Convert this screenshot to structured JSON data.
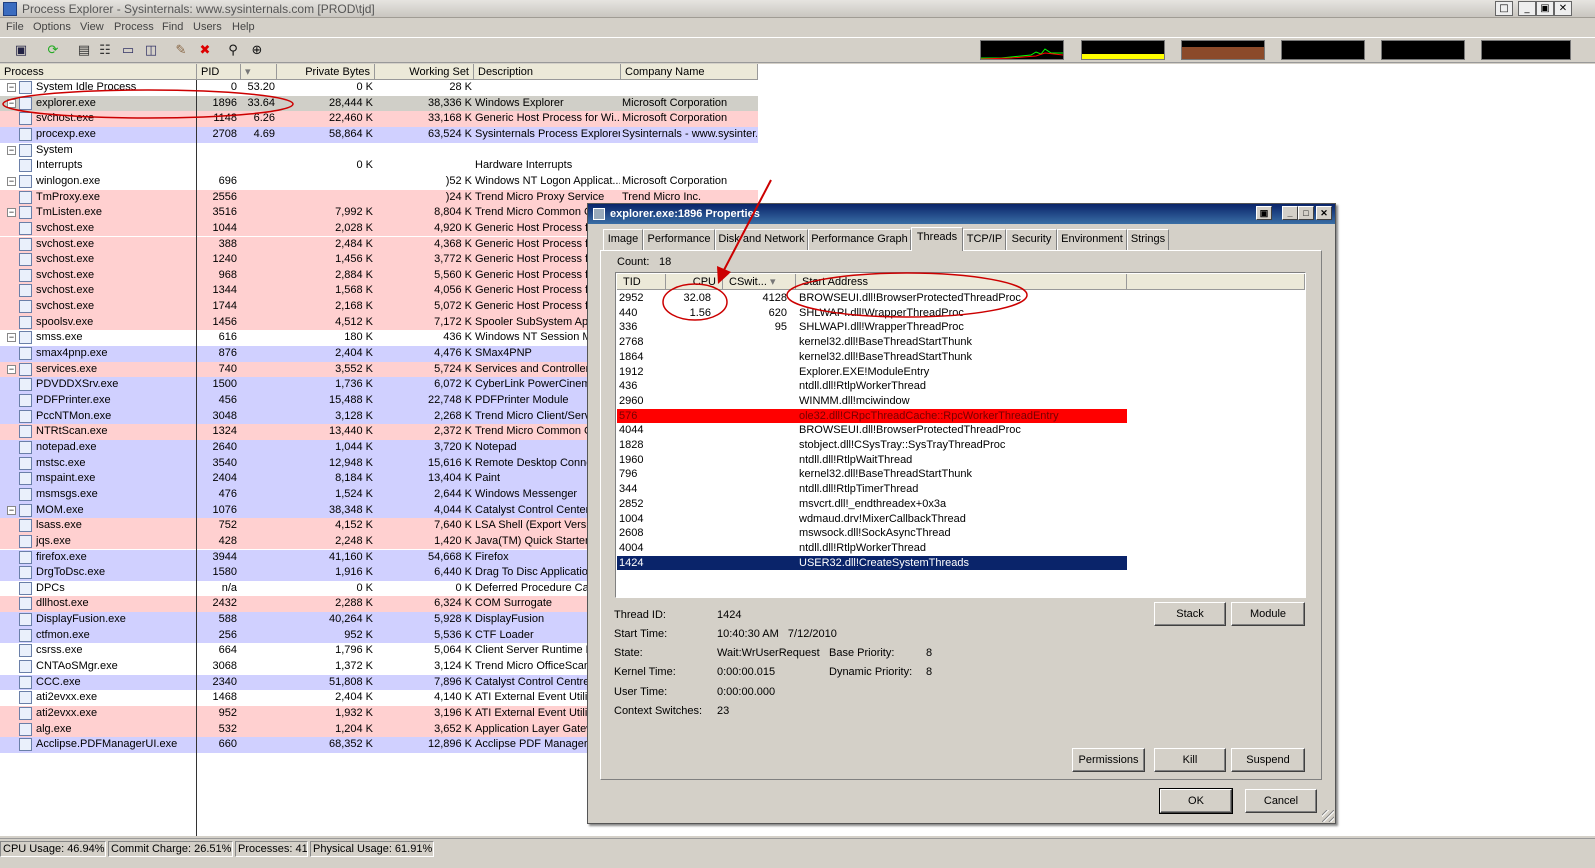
{
  "window": {
    "title": "Process Explorer - Sysinternals: www.sysinternals.com [PROD\\tjd]",
    "controls": [
      "□",
      "_",
      "▣",
      "✕"
    ]
  },
  "menu": [
    "File",
    "Options",
    "View",
    "Process",
    "Find",
    "Users",
    "Help"
  ],
  "toolbar": {
    "icons": [
      "save-icon",
      "refresh-icon",
      "system-info-icon",
      "process-tree-icon",
      "lower-pane-icon",
      "find-window-icon",
      "properties-icon",
      "kill-process-icon",
      "find-handle-icon",
      "target-icon"
    ]
  },
  "columns": {
    "process": "Process",
    "pid": "PID",
    "cpu": "",
    "private": "Private Bytes",
    "working": "Working Set",
    "desc": "Description",
    "company": "Company Name"
  },
  "processes": [
    {
      "name": "System Idle Process",
      "pid": "0",
      "cpu": "53.20",
      "priv": "0 K",
      "ws": "28 K",
      "desc": "",
      "company": "",
      "color": "none",
      "exp": "⊟"
    },
    {
      "name": "explorer.exe",
      "pid": "1896",
      "cpu": "33.64",
      "priv": "28,444 K",
      "ws": "38,336 K",
      "desc": "Windows Explorer",
      "company": "Microsoft Corporation",
      "color": "sel",
      "exp": "⊟"
    },
    {
      "name": "svchost.exe",
      "pid": "1148",
      "cpu": "6.26",
      "priv": "22,460 K",
      "ws": "33,168 K",
      "desc": "Generic Host Process for Wi...",
      "company": "Microsoft Corporation",
      "color": "pink",
      "exp": ""
    },
    {
      "name": "procexp.exe",
      "pid": "2708",
      "cpu": "4.69",
      "priv": "58,864 K",
      "ws": "63,524 K",
      "desc": "Sysinternals Process Explorer",
      "company": "Sysinternals - www.sysinter...",
      "color": "blue",
      "exp": ""
    },
    {
      "name": "System",
      "pid": "",
      "cpu": "",
      "priv": "",
      "ws": "",
      "desc": "",
      "company": "",
      "color": "none",
      "exp": "⊟"
    },
    {
      "name": "Interrupts",
      "pid": "",
      "cpu": "",
      "priv": "0 K",
      "ws": "",
      "desc": "Hardware Interrupts",
      "company": "",
      "color": "white",
      "exp": ""
    },
    {
      "name": "winlogon.exe",
      "pid": "696",
      "cpu": "",
      "priv": "",
      "ws": ")52 K",
      "desc": "Windows NT Logon Applicat...",
      "company": "Microsoft Corporation",
      "color": "white",
      "exp": "⊟"
    },
    {
      "name": "TmProxy.exe",
      "pid": "2556",
      "cpu": "",
      "priv": "",
      "ws": ")24 K",
      "desc": "Trend Micro Proxy Service",
      "company": "Trend Micro Inc.",
      "color": "pink",
      "exp": ""
    },
    {
      "name": "TmListen.exe",
      "pid": "3516",
      "cpu": "",
      "priv": "7,992 K",
      "ws": "8,804 K",
      "desc": "Trend Micro Common Cl",
      "company": "",
      "color": "pink",
      "exp": "⊟"
    },
    {
      "name": "svchost.exe",
      "pid": "1044",
      "cpu": "",
      "priv": "2,028 K",
      "ws": "4,920 K",
      "desc": "Generic Host Process fc",
      "company": "",
      "color": "pink",
      "exp": ""
    },
    {
      "name": "svchost.exe",
      "pid": "388",
      "cpu": "",
      "priv": "2,484 K",
      "ws": "4,368 K",
      "desc": "Generic Host Process fc",
      "company": "",
      "color": "pink",
      "exp": ""
    },
    {
      "name": "svchost.exe",
      "pid": "1240",
      "cpu": "",
      "priv": "1,456 K",
      "ws": "3,772 K",
      "desc": "Generic Host Process fc",
      "company": "",
      "color": "pink",
      "exp": ""
    },
    {
      "name": "svchost.exe",
      "pid": "968",
      "cpu": "",
      "priv": "2,884 K",
      "ws": "5,560 K",
      "desc": "Generic Host Process fc",
      "company": "",
      "color": "pink",
      "exp": ""
    },
    {
      "name": "svchost.exe",
      "pid": "1344",
      "cpu": "",
      "priv": "1,568 K",
      "ws": "4,056 K",
      "desc": "Generic Host Process fc",
      "company": "",
      "color": "pink",
      "exp": ""
    },
    {
      "name": "svchost.exe",
      "pid": "1744",
      "cpu": "",
      "priv": "2,168 K",
      "ws": "5,072 K",
      "desc": "Generic Host Process fc",
      "company": "",
      "color": "pink",
      "exp": ""
    },
    {
      "name": "spoolsv.exe",
      "pid": "1456",
      "cpu": "",
      "priv": "4,512 K",
      "ws": "7,172 K",
      "desc": "Spooler SubSystem App",
      "company": "",
      "color": "pink",
      "exp": ""
    },
    {
      "name": "smss.exe",
      "pid": "616",
      "cpu": "",
      "priv": "180 K",
      "ws": "436 K",
      "desc": "Windows NT Session M",
      "company": "",
      "color": "white",
      "exp": "⊟"
    },
    {
      "name": "smax4pnp.exe",
      "pid": "876",
      "cpu": "",
      "priv": "2,404 K",
      "ws": "4,476 K",
      "desc": "SMax4PNP",
      "company": "",
      "color": "blue",
      "exp": ""
    },
    {
      "name": "services.exe",
      "pid": "740",
      "cpu": "",
      "priv": "3,552 K",
      "ws": "5,724 K",
      "desc": "Services and Controller a",
      "company": "",
      "color": "pink",
      "exp": "⊟"
    },
    {
      "name": "PDVDDXSrv.exe",
      "pid": "1500",
      "cpu": "",
      "priv": "1,736 K",
      "ws": "6,072 K",
      "desc": "CyberLink PowerCinema",
      "company": "",
      "color": "blue",
      "exp": ""
    },
    {
      "name": "PDFPrinter.exe",
      "pid": "456",
      "cpu": "",
      "priv": "15,488 K",
      "ws": "22,748 K",
      "desc": "PDFPrinter Module",
      "company": "",
      "color": "blue",
      "exp": ""
    },
    {
      "name": "PccNTMon.exe",
      "pid": "3048",
      "cpu": "",
      "priv": "3,128 K",
      "ws": "2,268 K",
      "desc": "Trend Micro Client/Serv",
      "company": "",
      "color": "blue",
      "exp": ""
    },
    {
      "name": "NTRtScan.exe",
      "pid": "1324",
      "cpu": "",
      "priv": "13,440 K",
      "ws": "2,372 K",
      "desc": "Trend Micro Common Cl",
      "company": "",
      "color": "pink",
      "exp": ""
    },
    {
      "name": "notepad.exe",
      "pid": "2640",
      "cpu": "",
      "priv": "1,044 K",
      "ws": "3,720 K",
      "desc": "Notepad",
      "company": "",
      "color": "blue",
      "exp": ""
    },
    {
      "name": "mstsc.exe",
      "pid": "3540",
      "cpu": "",
      "priv": "12,948 K",
      "ws": "15,616 K",
      "desc": "Remote Desktop Conne",
      "company": "",
      "color": "blue",
      "exp": ""
    },
    {
      "name": "mspaint.exe",
      "pid": "2404",
      "cpu": "",
      "priv": "8,184 K",
      "ws": "13,404 K",
      "desc": "Paint",
      "company": "",
      "color": "blue",
      "exp": ""
    },
    {
      "name": "msmsgs.exe",
      "pid": "476",
      "cpu": "",
      "priv": "1,524 K",
      "ws": "2,644 K",
      "desc": "Windows Messenger",
      "company": "",
      "color": "blue",
      "exp": ""
    },
    {
      "name": "MOM.exe",
      "pid": "1076",
      "cpu": "",
      "priv": "38,348 K",
      "ws": "4,044 K",
      "desc": "Catalyst Control Center:",
      "company": "",
      "color": "blue",
      "exp": "⊟"
    },
    {
      "name": "lsass.exe",
      "pid": "752",
      "cpu": "",
      "priv": "4,152 K",
      "ws": "7,640 K",
      "desc": "LSA Shell (Export Versio",
      "company": "",
      "color": "pink",
      "exp": ""
    },
    {
      "name": "jqs.exe",
      "pid": "428",
      "cpu": "",
      "priv": "2,248 K",
      "ws": "1,420 K",
      "desc": "Java(TM) Quick Starter",
      "company": "",
      "color": "pink",
      "exp": ""
    },
    {
      "name": "firefox.exe",
      "pid": "3944",
      "cpu": "",
      "priv": "41,160 K",
      "ws": "54,668 K",
      "desc": "Firefox",
      "company": "",
      "color": "blue",
      "exp": ""
    },
    {
      "name": "DrgToDsc.exe",
      "pid": "1580",
      "cpu": "",
      "priv": "1,916 K",
      "ws": "6,440 K",
      "desc": "Drag To Disc Application",
      "company": "",
      "color": "blue",
      "exp": ""
    },
    {
      "name": "DPCs",
      "pid": "n/a",
      "cpu": "",
      "priv": "0 K",
      "ws": "0 K",
      "desc": "Deferred Procedure Call",
      "company": "",
      "color": "white",
      "exp": ""
    },
    {
      "name": "dllhost.exe",
      "pid": "2432",
      "cpu": "",
      "priv": "2,288 K",
      "ws": "6,324 K",
      "desc": "COM Surrogate",
      "company": "",
      "color": "pink",
      "exp": ""
    },
    {
      "name": "DisplayFusion.exe",
      "pid": "588",
      "cpu": "",
      "priv": "40,264 K",
      "ws": "5,928 K",
      "desc": "DisplayFusion",
      "company": "",
      "color": "blue",
      "exp": ""
    },
    {
      "name": "ctfmon.exe",
      "pid": "256",
      "cpu": "",
      "priv": "952 K",
      "ws": "5,536 K",
      "desc": "CTF Loader",
      "company": "",
      "color": "blue",
      "exp": ""
    },
    {
      "name": "csrss.exe",
      "pid": "664",
      "cpu": "",
      "priv": "1,796 K",
      "ws": "5,064 K",
      "desc": "Client Server Runtime P",
      "company": "",
      "color": "white",
      "exp": ""
    },
    {
      "name": "CNTAoSMgr.exe",
      "pid": "3068",
      "cpu": "",
      "priv": "1,372 K",
      "ws": "3,124 K",
      "desc": "Trend Micro OfficeScan",
      "company": "",
      "color": "white",
      "exp": ""
    },
    {
      "name": "CCC.exe",
      "pid": "2340",
      "cpu": "",
      "priv": "51,808 K",
      "ws": "7,896 K",
      "desc": "Catalyst Control Centre:",
      "company": "",
      "color": "blue",
      "exp": ""
    },
    {
      "name": "ati2evxx.exe",
      "pid": "1468",
      "cpu": "",
      "priv": "2,404 K",
      "ws": "4,140 K",
      "desc": "ATI External Event Utility",
      "company": "",
      "color": "white",
      "exp": ""
    },
    {
      "name": "ati2evxx.exe",
      "pid": "952",
      "cpu": "",
      "priv": "1,932 K",
      "ws": "3,196 K",
      "desc": "ATI External Event Utility",
      "company": "",
      "color": "pink",
      "exp": ""
    },
    {
      "name": "alg.exe",
      "pid": "532",
      "cpu": "",
      "priv": "1,204 K",
      "ws": "3,652 K",
      "desc": "Application Layer Gatew",
      "company": "",
      "color": "pink",
      "exp": ""
    },
    {
      "name": "Acclipse.PDFManagerUI.exe",
      "pid": "660",
      "cpu": "",
      "priv": "68,352 K",
      "ws": "12,896 K",
      "desc": "Acclipse PDF Manager",
      "company": "",
      "color": "blue",
      "exp": ""
    }
  ],
  "status": {
    "cpu": "CPU Usage: 46.94%",
    "commit": "Commit Charge: 26.51%",
    "procs": "Processes: 41",
    "phys": "Physical Usage: 61.91%"
  },
  "dialog": {
    "title": "explorer.exe:1896 Properties",
    "tabs": [
      "Image",
      "Performance",
      "Disk and Network",
      "Performance Graph",
      "Threads",
      "TCP/IP",
      "Security",
      "Environment",
      "Strings"
    ],
    "active_tab": "Threads",
    "count_label": "Count:",
    "count_value": "18",
    "thread_columns": {
      "tid": "TID",
      "cpu": "CPU",
      "cswitch": "CSwit...",
      "start": "Start Address"
    },
    "threads": [
      {
        "tid": "2952",
        "cpu": "32.08",
        "cs": "4128",
        "addr": "BROWSEUI.dll!BrowserProtectedThreadProc",
        "style": ""
      },
      {
        "tid": "440",
        "cpu": "1.56",
        "cs": "620",
        "addr": "SHLWAPI.dll!WrapperThreadProc",
        "style": ""
      },
      {
        "tid": "336",
        "cpu": "",
        "cs": "95",
        "addr": "SHLWAPI.dll!WrapperThreadProc",
        "style": ""
      },
      {
        "tid": "2768",
        "cpu": "",
        "cs": "",
        "addr": "kernel32.dll!BaseThreadStartThunk",
        "style": ""
      },
      {
        "tid": "1864",
        "cpu": "",
        "cs": "",
        "addr": "kernel32.dll!BaseThreadStartThunk",
        "style": ""
      },
      {
        "tid": "1912",
        "cpu": "",
        "cs": "",
        "addr": "Explorer.EXE!ModuleEntry",
        "style": ""
      },
      {
        "tid": "436",
        "cpu": "",
        "cs": "",
        "addr": "ntdll.dll!RtlpWorkerThread",
        "style": ""
      },
      {
        "tid": "2960",
        "cpu": "",
        "cs": "",
        "addr": "WINMM.dll!mciwindow",
        "style": ""
      },
      {
        "tid": "576",
        "cpu": "",
        "cs": "",
        "addr": "ole32.dll!CRpcThreadCache::RpcWorkerThreadEntry",
        "style": "red"
      },
      {
        "tid": "4044",
        "cpu": "",
        "cs": "",
        "addr": "BROWSEUI.dll!BrowserProtectedThreadProc",
        "style": ""
      },
      {
        "tid": "1828",
        "cpu": "",
        "cs": "",
        "addr": "stobject.dll!CSysTray::SysTrayThreadProc",
        "style": ""
      },
      {
        "tid": "1960",
        "cpu": "",
        "cs": "",
        "addr": "ntdll.dll!RtlpWaitThread",
        "style": ""
      },
      {
        "tid": "796",
        "cpu": "",
        "cs": "",
        "addr": "kernel32.dll!BaseThreadStartThunk",
        "style": ""
      },
      {
        "tid": "344",
        "cpu": "",
        "cs": "",
        "addr": "ntdll.dll!RtlpTimerThread",
        "style": ""
      },
      {
        "tid": "2852",
        "cpu": "",
        "cs": "",
        "addr": "msvcrt.dll!_endthreadex+0x3a",
        "style": ""
      },
      {
        "tid": "1004",
        "cpu": "",
        "cs": "",
        "addr": "wdmaud.drv!MixerCallbackThread",
        "style": ""
      },
      {
        "tid": "2608",
        "cpu": "",
        "cs": "",
        "addr": "mswsock.dll!SockAsyncThread",
        "style": ""
      },
      {
        "tid": "4004",
        "cpu": "",
        "cs": "",
        "addr": "ntdll.dll!RtlpWorkerThread",
        "style": ""
      },
      {
        "tid": "1424",
        "cpu": "",
        "cs": "",
        "addr": "USER32.dll!CreateSystemThreads",
        "style": "nav"
      }
    ],
    "details": {
      "thread_id_label": "Thread ID:",
      "thread_id": "1424",
      "start_time_label": "Start Time:",
      "start_time": "10:40:30 AM   7/12/2010",
      "state_label": "State:",
      "state": "Wait:WrUserRequest",
      "base_pri_label": "Base Priority:",
      "base_pri": "8",
      "kernel_label": "Kernel Time:",
      "kernel": "0:00:00.015",
      "dyn_pri_label": "Dynamic Priority:",
      "dyn_pri": "8",
      "user_label": "User Time:",
      "user": "0:00:00.000",
      "ctx_label": "Context Switches:",
      "ctx": "23"
    },
    "buttons": {
      "stack": "Stack",
      "module": "Module",
      "permissions": "Permissions",
      "kill": "Kill",
      "suspend": "Suspend",
      "ok": "OK",
      "cancel": "Cancel"
    }
  }
}
